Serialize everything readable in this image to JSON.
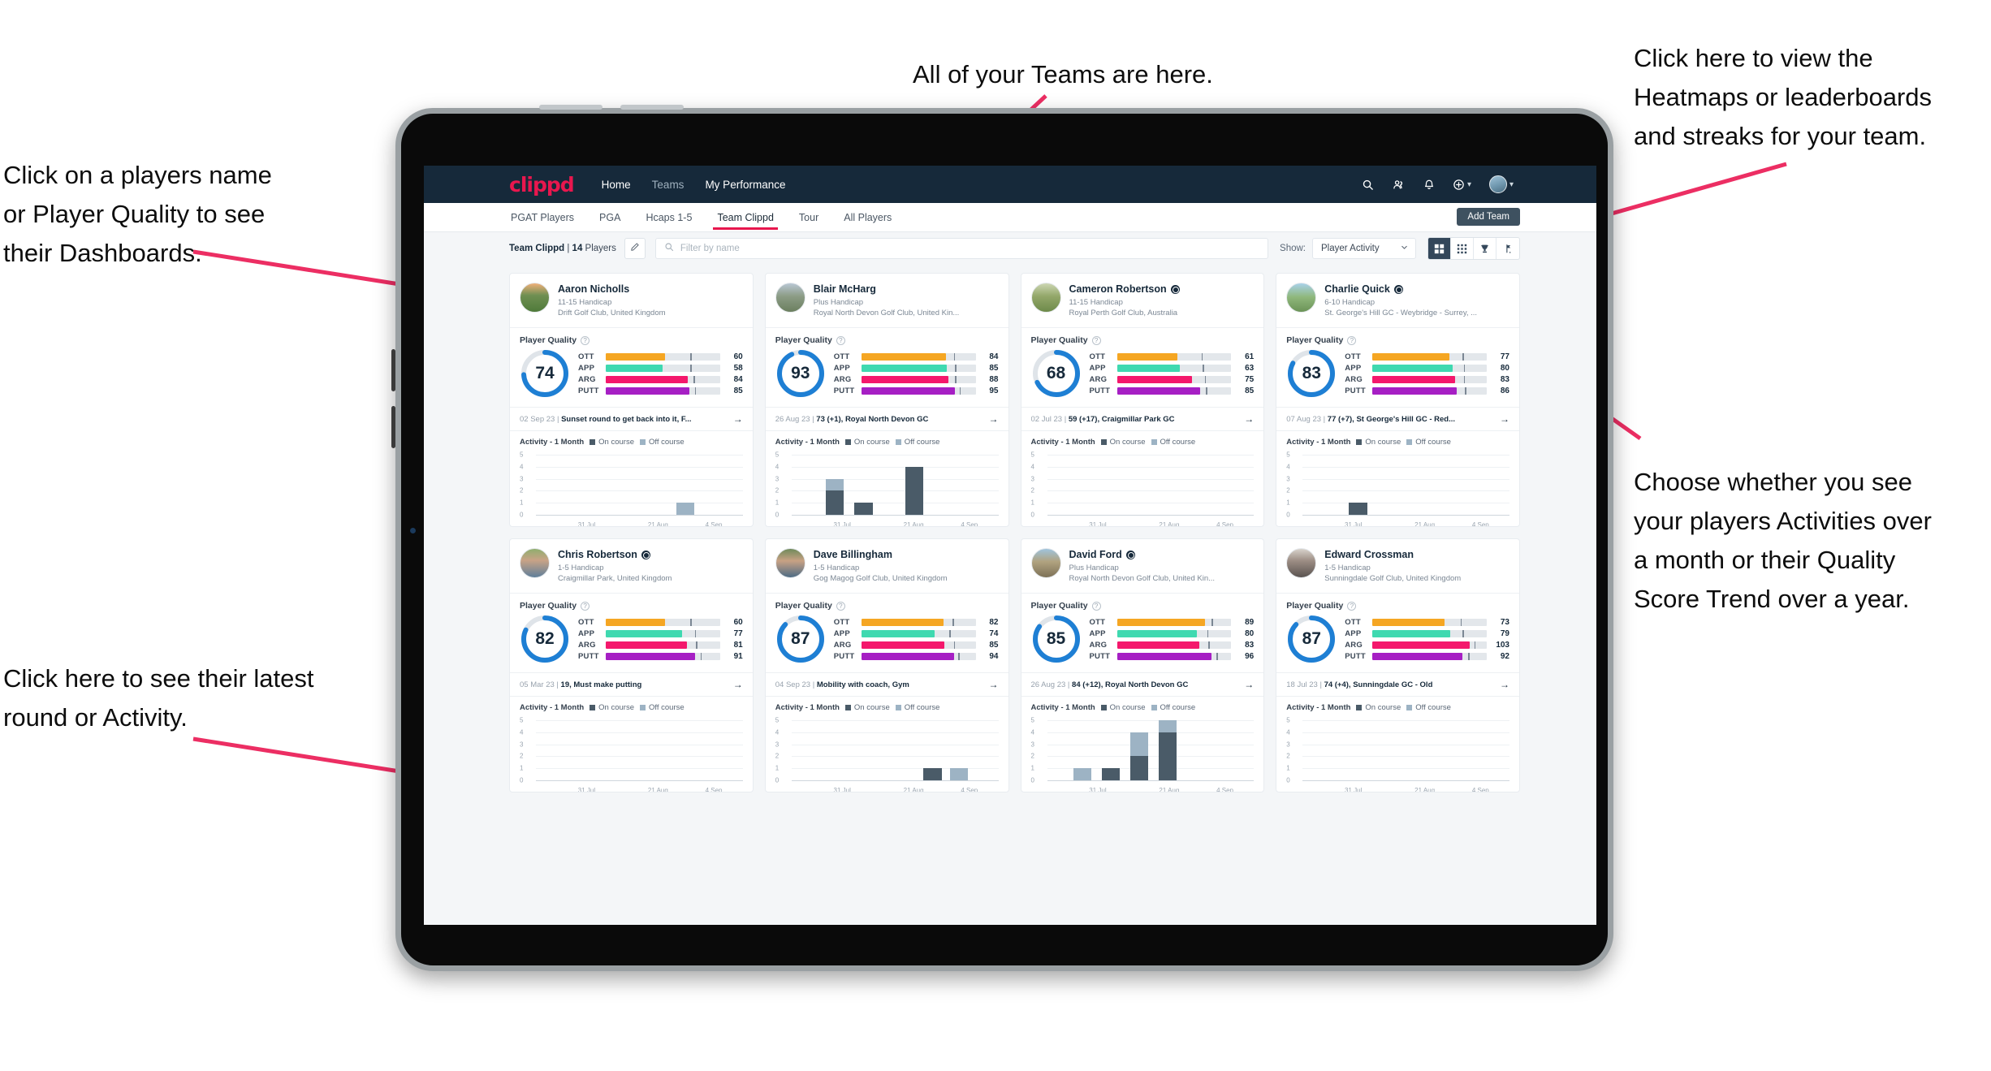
{
  "annotations": [
    {
      "id": "teams",
      "text": "All of your Teams are here."
    },
    {
      "id": "heatmaps",
      "text": "Click here to view the\nHeatmaps or leaderboards\nand streaks for your team."
    },
    {
      "id": "players-name",
      "text": "Click on a players name\nor Player Quality to see\ntheir Dashboards."
    },
    {
      "id": "activity-choice",
      "text": "Choose whether you see\nyour players Activities over\na month or their Quality\nScore Trend over a year."
    },
    {
      "id": "latest-round",
      "text": "Click here to see their latest\nround or Activity."
    }
  ],
  "nav": {
    "logo": "clippd",
    "links": [
      {
        "label": "Home",
        "active": true
      },
      {
        "label": "Teams",
        "active": false
      },
      {
        "label": "My Performance",
        "active": true
      }
    ],
    "icons": [
      "search-icon",
      "people-icon",
      "bell-icon",
      "plus-circle-icon",
      "avatar"
    ]
  },
  "tabs": {
    "items": [
      {
        "label": "PGAT Players",
        "active": false
      },
      {
        "label": "PGA",
        "active": false
      },
      {
        "label": "Hcaps 1-5",
        "active": false
      },
      {
        "label": "Team Clippd",
        "active": true
      },
      {
        "label": "Tour",
        "active": false
      },
      {
        "label": "All Players",
        "active": false
      }
    ],
    "add_team_label": "Add Team"
  },
  "toolbar": {
    "team_name": "Team Clippd",
    "separator": " | ",
    "player_count": "14",
    "players_word": " Players",
    "edit_icon": "pencil-icon",
    "search_placeholder": "Filter by name",
    "show_label": "Show:",
    "show_value": "Player Activity",
    "view_buttons": [
      "grid-large-icon",
      "grid-small-icon",
      "trophy-icon",
      "flag-icon"
    ]
  },
  "colors": {
    "brand_pink": "#e8174e",
    "nav_dark": "#16293a",
    "ott": "#f5a623",
    "app": "#3fd9b0",
    "arg": "#f4186c",
    "putt": "#a61fc4",
    "ring": "#1e7fd4",
    "on_course": "#4a5b68",
    "off_course": "#9db3c4"
  },
  "chart_data": {
    "type": "bar",
    "title": "Activity - 1 Month",
    "legend": [
      "On course",
      "Off course"
    ],
    "xlabel": "",
    "ylabel": "",
    "ylim": [
      0,
      5
    ],
    "yticks": [
      "5",
      "4",
      "3",
      "2",
      "1",
      "0"
    ],
    "xticks": [
      "31 Jul",
      "21 Aug",
      "4 Sep"
    ],
    "grid": true,
    "legend_position": "top"
  },
  "players": [
    {
      "name": "Aaron Nicholls",
      "verified": false,
      "handicap": "11-15 Handicap",
      "club": "Drift Golf Club, United Kingdom",
      "quality_label": "Player Quality",
      "score": "74",
      "score_pct": 74,
      "metrics": [
        {
          "label": "OTT",
          "value": "60",
          "fill": 52,
          "tick": 74
        },
        {
          "label": "APP",
          "value": "58",
          "fill": 50,
          "tick": 74
        },
        {
          "label": "ARG",
          "value": "84",
          "fill": 72,
          "tick": 77
        },
        {
          "label": "PUTT",
          "value": "85",
          "fill": 73,
          "tick": 78
        }
      ],
      "round_date": "02 Sep 23",
      "round_text": "Sunset round to get back into it, F...",
      "activity": {
        "bars": [
          {
            "x": 68,
            "on": 0,
            "off": 1
          }
        ]
      },
      "avatar_css": "linear-gradient(180deg,#f0b07a 0%,#6f8f52 42%,#4f7a3a 100%)"
    },
    {
      "name": "Blair McHarg",
      "verified": false,
      "handicap": "Plus Handicap",
      "club": "Royal North Devon Golf Club, United Kin...",
      "quality_label": "Player Quality",
      "score": "93",
      "score_pct": 93,
      "metrics": [
        {
          "label": "OTT",
          "value": "84",
          "fill": 74,
          "tick": 81
        },
        {
          "label": "APP",
          "value": "85",
          "fill": 75,
          "tick": 82
        },
        {
          "label": "ARG",
          "value": "88",
          "fill": 76,
          "tick": 82
        },
        {
          "label": "PUTT",
          "value": "95",
          "fill": 82,
          "tick": 86
        }
      ],
      "round_date": "26 Aug 23",
      "round_text": "73 (+1), Royal North Devon GC",
      "activity": {
        "bars": [
          {
            "x": 16,
            "on": 2,
            "off": 1
          },
          {
            "x": 30,
            "on": 1,
            "off": 0
          },
          {
            "x": 55,
            "on": 4,
            "off": 0
          }
        ]
      },
      "avatar_css": "linear-gradient(180deg,#b9c7d4 0%,#8c9c86 45%,#6b7f5f 100%)"
    },
    {
      "name": "Cameron Robertson",
      "verified": true,
      "handicap": "11-15 Handicap",
      "club": "Royal Perth Golf Club, Australia",
      "quality_label": "Player Quality",
      "score": "68",
      "score_pct": 68,
      "metrics": [
        {
          "label": "OTT",
          "value": "61",
          "fill": 53,
          "tick": 74
        },
        {
          "label": "APP",
          "value": "63",
          "fill": 55,
          "tick": 75
        },
        {
          "label": "ARG",
          "value": "75",
          "fill": 66,
          "tick": 77
        },
        {
          "label": "PUTT",
          "value": "85",
          "fill": 73,
          "tick": 78
        }
      ],
      "round_date": "02 Jul 23",
      "round_text": "59 (+17), Craigmillar Park GC",
      "activity": {
        "bars": []
      },
      "avatar_css": "linear-gradient(180deg,#cdd6b3 0%,#93a76a 45%,#6d8a4a 100%)"
    },
    {
      "name": "Charlie Quick",
      "verified": true,
      "handicap": "6-10 Handicap",
      "club": "St. George's Hill GC - Weybridge - Surrey, ...",
      "quality_label": "Player Quality",
      "score": "83",
      "score_pct": 83,
      "metrics": [
        {
          "label": "OTT",
          "value": "77",
          "fill": 67,
          "tick": 79
        },
        {
          "label": "APP",
          "value": "80",
          "fill": 70,
          "tick": 80
        },
        {
          "label": "ARG",
          "value": "83",
          "fill": 72,
          "tick": 80
        },
        {
          "label": "PUTT",
          "value": "86",
          "fill": 74,
          "tick": 81
        }
      ],
      "round_date": "07 Aug 23",
      "round_text": "77 (+7), St George's Hill GC - Red...",
      "activity": {
        "bars": [
          {
            "x": 22,
            "on": 1,
            "off": 0
          }
        ]
      },
      "avatar_css": "linear-gradient(180deg,#a9d2ea 0%,#8fb87c 48%,#6b9357 100%)"
    },
    {
      "name": "Chris Robertson",
      "verified": true,
      "handicap": "1-5 Handicap",
      "club": "Craigmillar Park, United Kingdom",
      "quality_label": "Player Quality",
      "score": "82",
      "score_pct": 82,
      "metrics": [
        {
          "label": "OTT",
          "value": "60",
          "fill": 52,
          "tick": 74
        },
        {
          "label": "APP",
          "value": "77",
          "fill": 67,
          "tick": 78
        },
        {
          "label": "ARG",
          "value": "81",
          "fill": 71,
          "tick": 79
        },
        {
          "label": "PUTT",
          "value": "91",
          "fill": 78,
          "tick": 83
        }
      ],
      "round_date": "05 Mar 23",
      "round_text": "19, Must make putting",
      "activity": {
        "bars": []
      },
      "avatar_css": "linear-gradient(180deg,#8fae6e 0%,#c9a386 40%,#5f7f9a 100%)"
    },
    {
      "name": "Dave Billingham",
      "verified": false,
      "handicap": "1-5 Handicap",
      "club": "Gog Magog Golf Club, United Kingdom",
      "quality_label": "Player Quality",
      "score": "87",
      "score_pct": 87,
      "metrics": [
        {
          "label": "OTT",
          "value": "82",
          "fill": 72,
          "tick": 80
        },
        {
          "label": "APP",
          "value": "74",
          "fill": 64,
          "tick": 77
        },
        {
          "label": "ARG",
          "value": "85",
          "fill": 73,
          "tick": 81
        },
        {
          "label": "PUTT",
          "value": "94",
          "fill": 81,
          "tick": 85
        }
      ],
      "round_date": "04 Sep 23",
      "round_text": "Mobility with coach, Gym",
      "activity": {
        "bars": [
          {
            "x": 64,
            "on": 1,
            "off": 0
          },
          {
            "x": 77,
            "on": 0,
            "off": 1
          }
        ]
      },
      "avatar_css": "linear-gradient(180deg,#6f8a5a 0%,#c8a184 42%,#4d6b84 100%)"
    },
    {
      "name": "David Ford",
      "verified": true,
      "handicap": "Plus Handicap",
      "club": "Royal North Devon Golf Club, United Kin...",
      "quality_label": "Player Quality",
      "score": "85",
      "score_pct": 85,
      "metrics": [
        {
          "label": "OTT",
          "value": "89",
          "fill": 77,
          "tick": 83
        },
        {
          "label": "APP",
          "value": "80",
          "fill": 70,
          "tick": 79
        },
        {
          "label": "ARG",
          "value": "83",
          "fill": 72,
          "tick": 80
        },
        {
          "label": "PUTT",
          "value": "96",
          "fill": 83,
          "tick": 87
        }
      ],
      "round_date": "26 Aug 23",
      "round_text": "84 (+12), Royal North Devon GC",
      "activity": {
        "bars": [
          {
            "x": 12,
            "on": 0,
            "off": 1
          },
          {
            "x": 26,
            "on": 1,
            "off": 0
          },
          {
            "x": 40,
            "on": 2,
            "off": 2
          },
          {
            "x": 54,
            "on": 4,
            "off": 1
          }
        ]
      },
      "avatar_css": "linear-gradient(180deg,#9fc4dd 0%,#b0a27f 45%,#7d7157 100%)"
    },
    {
      "name": "Edward Crossman",
      "verified": false,
      "handicap": "1-5 Handicap",
      "club": "Sunningdale Golf Club, United Kingdom",
      "quality_label": "Player Quality",
      "score": "87",
      "score_pct": 87,
      "metrics": [
        {
          "label": "OTT",
          "value": "73",
          "fill": 63,
          "tick": 77
        },
        {
          "label": "APP",
          "value": "79",
          "fill": 68,
          "tick": 79
        },
        {
          "label": "ARG",
          "value": "103",
          "fill": 85,
          "tick": 89
        },
        {
          "label": "PUTT",
          "value": "92",
          "fill": 79,
          "tick": 84
        }
      ],
      "round_date": "18 Jul 23",
      "round_text": "74 (+4), Sunningdale GC - Old",
      "activity": {
        "bars": []
      },
      "avatar_css": "linear-gradient(180deg,#d8d3cc 0%,#9c8d84 42%,#5a5350 100%)"
    }
  ]
}
